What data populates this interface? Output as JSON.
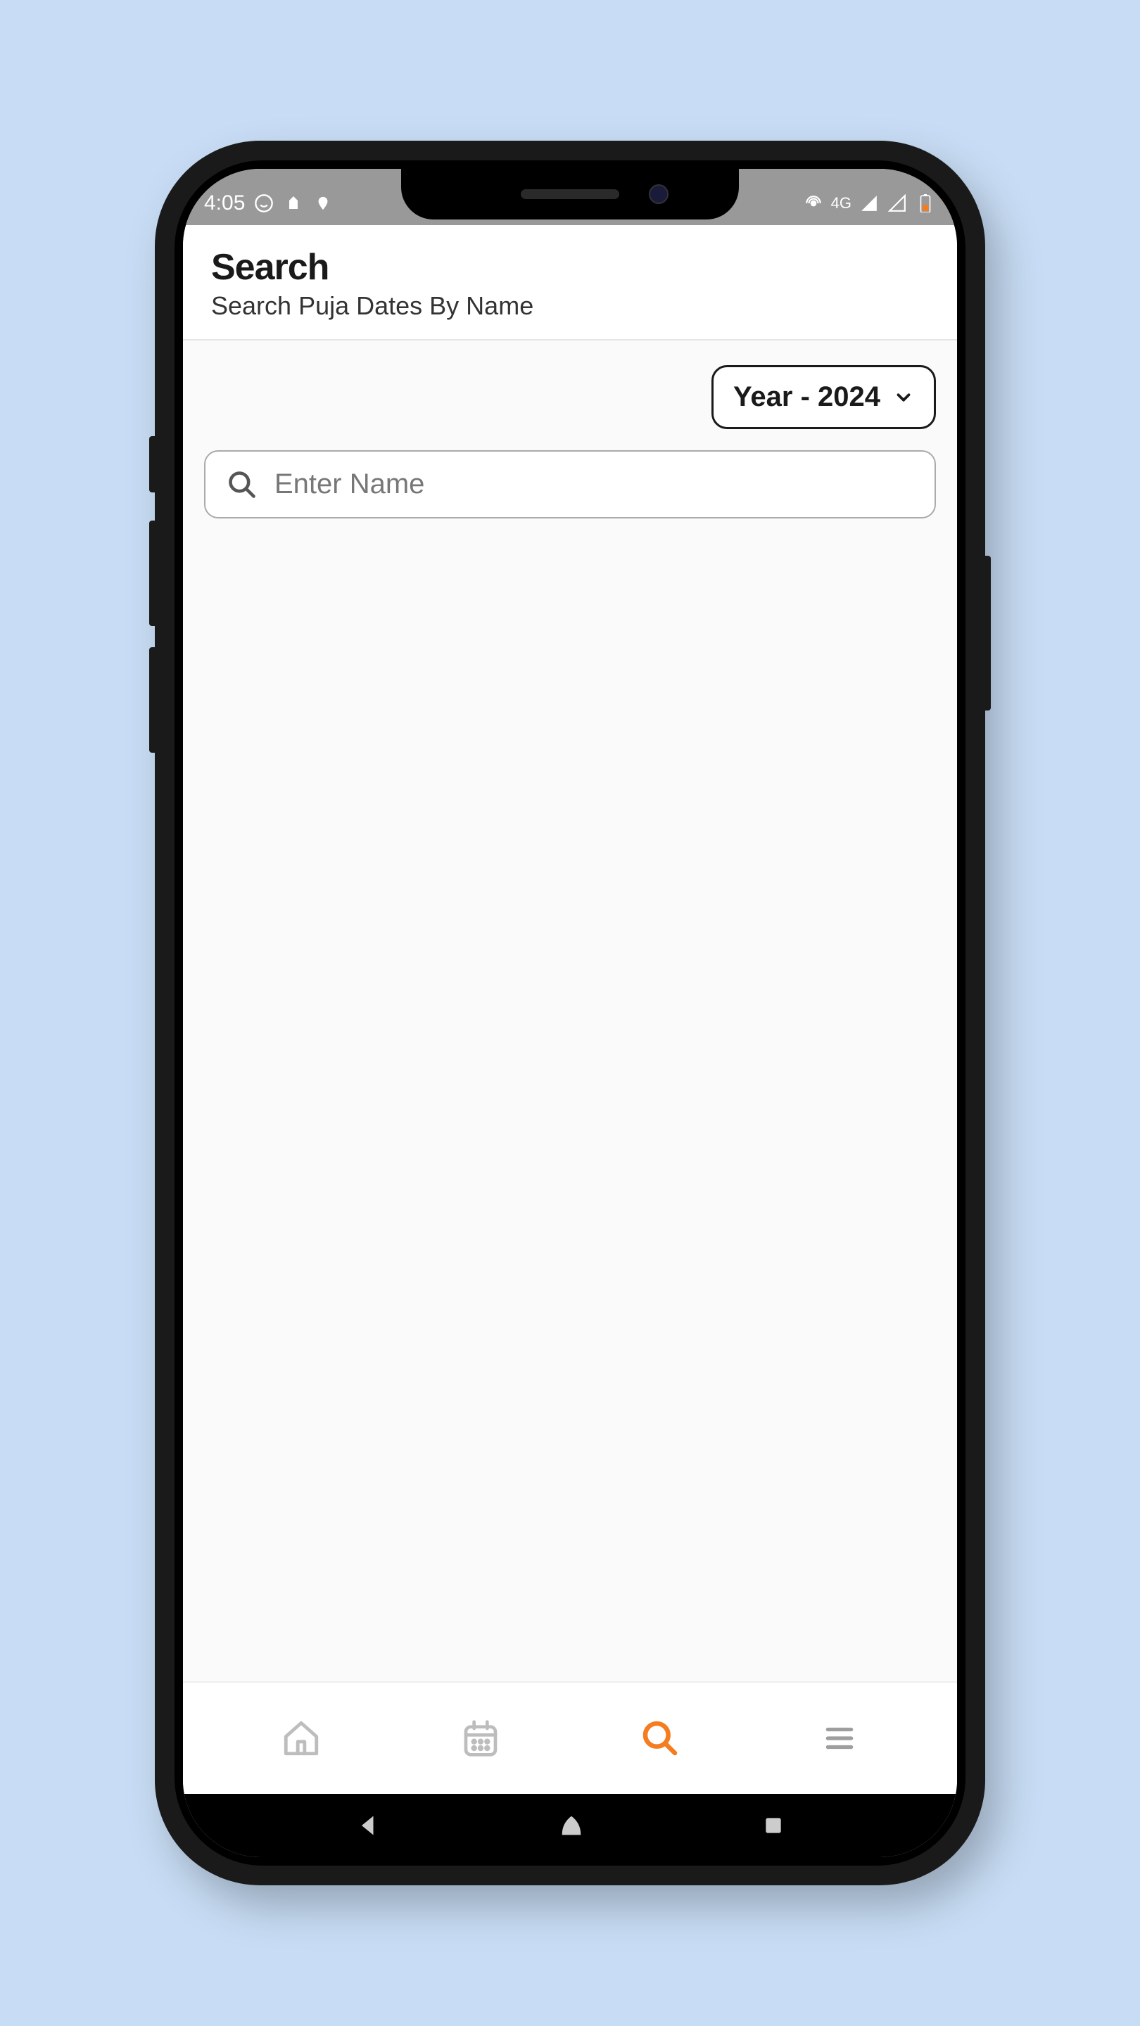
{
  "statusBar": {
    "time": "4:05",
    "network": "4G"
  },
  "header": {
    "title": "Search",
    "subtitle": "Search Puja Dates By Name"
  },
  "controls": {
    "yearLabel": "Year - 2024",
    "searchPlaceholder": "Enter Name",
    "searchValue": ""
  },
  "nav": {
    "items": [
      {
        "name": "home",
        "active": false
      },
      {
        "name": "calendar",
        "active": false
      },
      {
        "name": "search",
        "active": true
      },
      {
        "name": "menu",
        "active": false
      }
    ]
  },
  "colors": {
    "accent": "#f57c1f",
    "inactive": "#bdbdbd",
    "text": "#1a1a1a"
  }
}
